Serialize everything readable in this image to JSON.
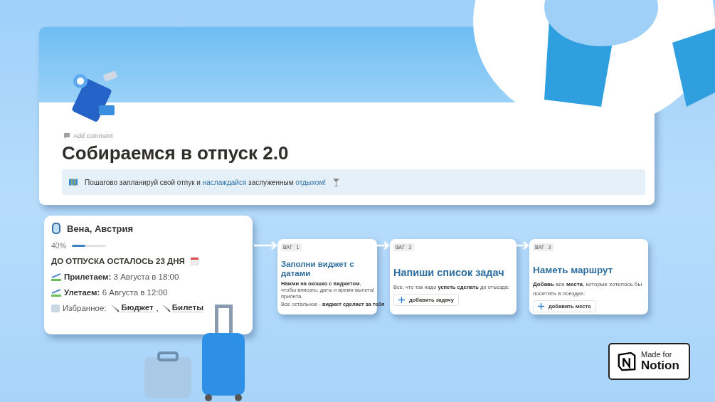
{
  "page": {
    "add_comment": "Add comment",
    "title": "Собираемся в отпуск 2.0",
    "callout": [
      {
        "text": "Пошагово запланируй свой отпук и ",
        "kind": "plain"
      },
      {
        "text": "наслаждайся",
        "kind": "link"
      },
      {
        "text": " заслуженным ",
        "kind": "plain"
      },
      {
        "text": "отдыхом!",
        "kind": "link"
      }
    ]
  },
  "widget": {
    "title": "Вена, Австрия",
    "progress": {
      "reading": "40%",
      "level": 0.4
    },
    "countdown": "ДО ОТПУСКА ОСТАЛОСЬ 23  ДНЯ",
    "arrive": {
      "label": "Прилетаем:",
      "value": "3 Августа в 18:00"
    },
    "depart": {
      "label": "Улетаем:",
      "value": "6 Августа в 12:00"
    },
    "favorites": {
      "label": "Избранное:",
      "separator": ",",
      "links": [
        "Бюджет",
        "Билеты"
      ]
    }
  },
  "steps": [
    {
      "badge": "ШАГ 1",
      "title": "Заполни виджет с датами",
      "body": "**Нажми на окошко с виджетом**, чтобы вписать: даты и время вылета/прилета.",
      "note": "Все остальное - **виджет сделает за тебя**"
    },
    {
      "badge": "ШАГ 2",
      "title": "Напиши список задач",
      "body": "Все, что так надо **успеть сделать** до отъезда:",
      "button": "добавить задачу"
    },
    {
      "badge": "ШАГ 3",
      "title": "Наметь маршрут",
      "body": "**Добавь** все **места**, которые хотелось бы посетить в поездке:",
      "button": "добавить место"
    }
  ],
  "badge": {
    "line1": "Made for",
    "line2": "Notion"
  }
}
